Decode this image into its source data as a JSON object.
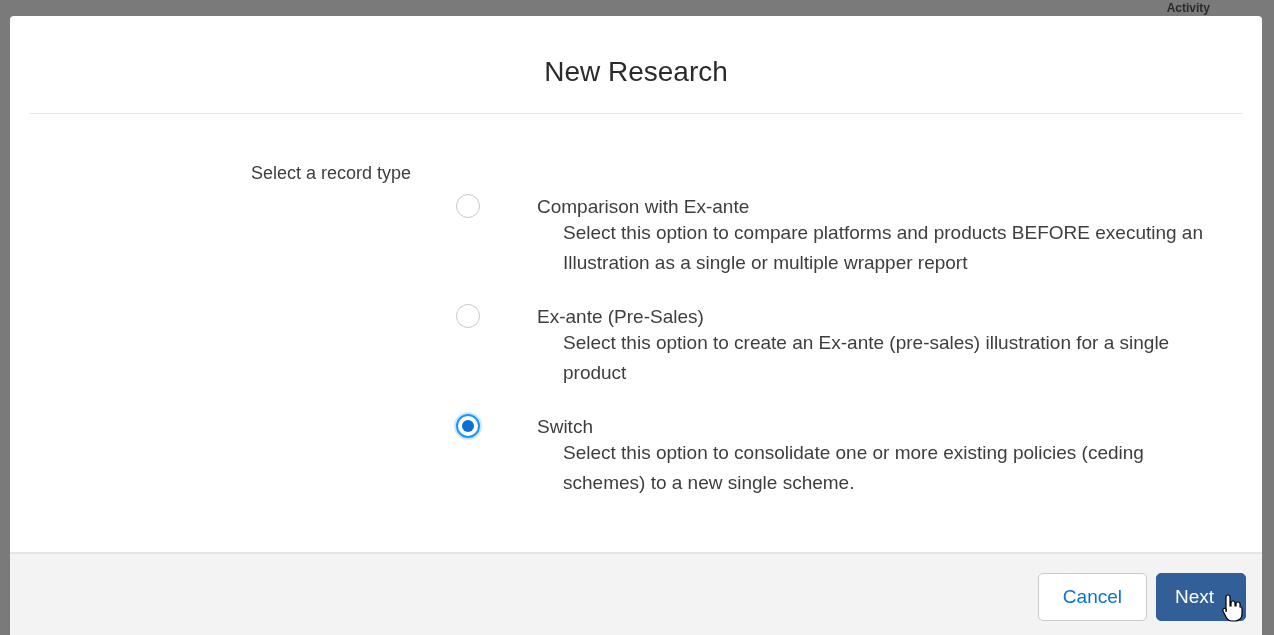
{
  "background": {
    "heading": "Activity"
  },
  "modal": {
    "title": "New Research",
    "prompt": "Select a record type",
    "options": [
      {
        "label": "Comparison with Ex-ante",
        "description": "Select this option to compare platforms and products BEFORE executing an Illustration as a single or multiple wrapper report",
        "selected": false
      },
      {
        "label": "Ex-ante (Pre-Sales)",
        "description": "Select this option to create an Ex-ante (pre-sales) illustration for a single product",
        "selected": false
      },
      {
        "label": "Switch",
        "description": "Select this option to consolidate one or more existing policies (ceding schemes) to a new single scheme.",
        "selected": true
      }
    ],
    "buttons": [
      {
        "label": "Cancel",
        "kind": "neutral"
      },
      {
        "label": "Next",
        "kind": "brand"
      }
    ]
  }
}
